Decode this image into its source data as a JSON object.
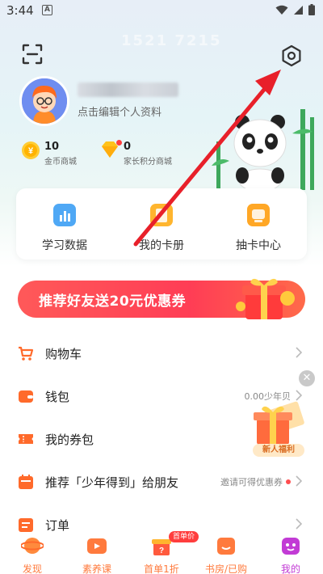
{
  "status_bar": {
    "time": "3:44",
    "notification_letter": "A"
  },
  "header": {
    "watermark_text": "1521   7215"
  },
  "profile": {
    "edit_hint": "点击编辑个人资料"
  },
  "stats": [
    {
      "value": "10",
      "label": "金币商城",
      "icon": "coin-icon"
    },
    {
      "value": "0",
      "label": "家长积分商城",
      "icon": "diamond-icon"
    }
  ],
  "quick_card": [
    {
      "label": "学习数据",
      "icon": "bar-chart-icon"
    },
    {
      "label": "我的卡册",
      "icon": "card-album-icon"
    },
    {
      "label": "抽卡中心",
      "icon": "card-draw-icon"
    }
  ],
  "banner": {
    "text": "推荐好友送20元优惠券"
  },
  "menu": [
    {
      "label": "购物车",
      "icon": "cart-icon",
      "right_text": ""
    },
    {
      "label": "钱包",
      "icon": "wallet-icon",
      "right_text": "0.00少年贝"
    },
    {
      "label": "我的券包",
      "icon": "coupon-icon",
      "right_text": ""
    },
    {
      "label": "推荐「少年得到」给朋友",
      "icon": "calendar-icon",
      "right_text": "邀请可得优惠券"
    },
    {
      "label": "订单",
      "icon": "order-icon",
      "right_text": ""
    }
  ],
  "floating_promo": {
    "label": "新人福利"
  },
  "tabbar": {
    "first_order_badge": "首单价",
    "tabs": [
      {
        "label": "发现",
        "icon": "planet-icon"
      },
      {
        "label": "素养课",
        "icon": "tv-icon"
      },
      {
        "label": "首单1折",
        "icon": "mystery-box-icon"
      },
      {
        "label": "书房/已购",
        "icon": "bookshelf-icon"
      },
      {
        "label": "我的",
        "icon": "profile-face-icon"
      }
    ],
    "active_tab": "我的"
  },
  "colors": {
    "accent_orange": "#ff7a3d",
    "banner_red": "#ff4757",
    "active_tab_purple": "#c23bd5",
    "annotation_arrow": "#e8202a"
  }
}
